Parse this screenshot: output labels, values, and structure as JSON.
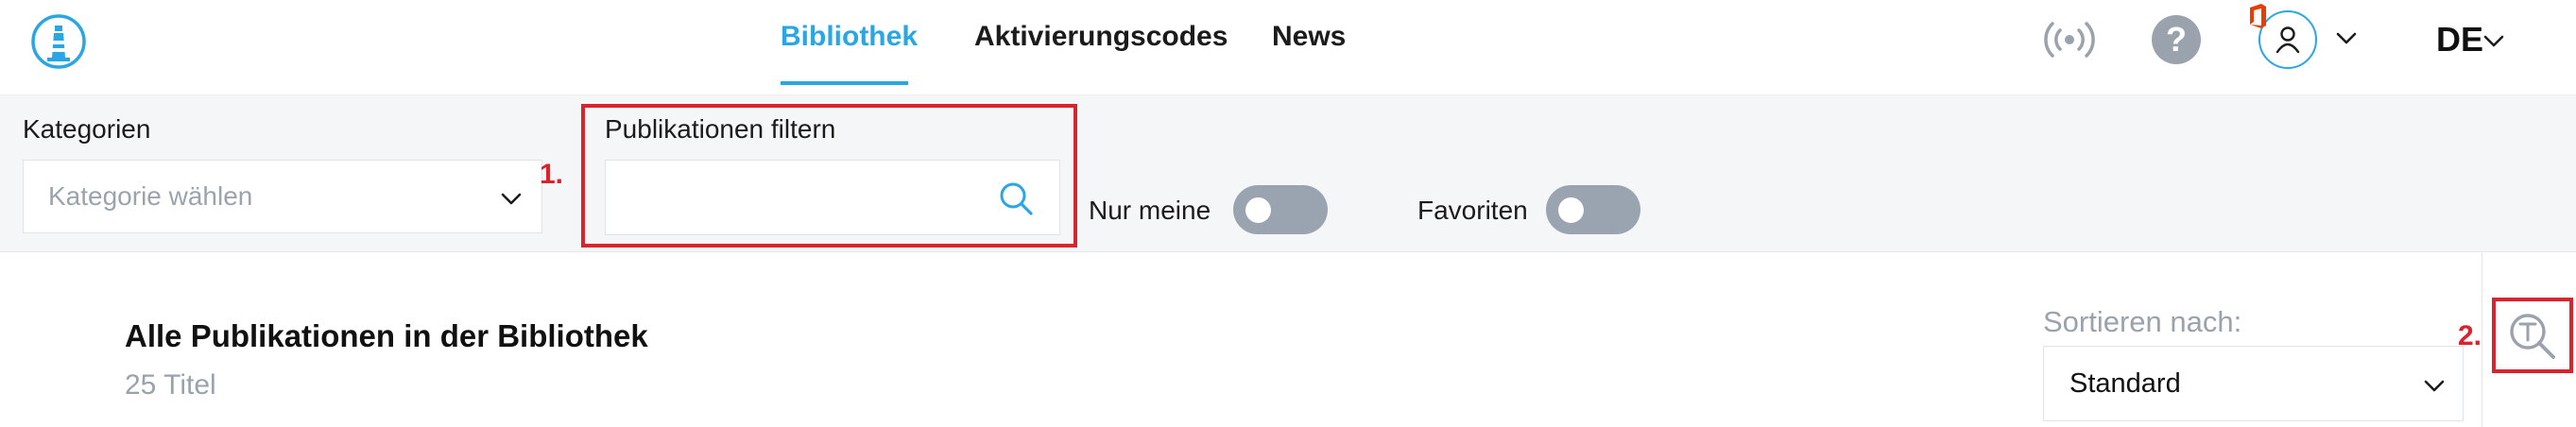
{
  "nav": {
    "items": [
      {
        "label": "Bibliothek",
        "active": true
      },
      {
        "label": "Aktivierungscodes",
        "active": false
      },
      {
        "label": "News",
        "active": false
      }
    ],
    "help_label": "?",
    "language": "DE"
  },
  "filters": {
    "category_label": "Kategorien",
    "category_placeholder": "Kategorie wählen",
    "publication_filter_label": "Publikationen filtern",
    "publication_filter_value": "",
    "only_mine_label": "Nur meine",
    "only_mine_on": false,
    "favorites_label": "Favoriten",
    "favorites_on": false
  },
  "content": {
    "title": "Alle Publikationen in der Bibliothek",
    "count": "25 Titel",
    "sort_label": "Sortieren nach:",
    "sort_value": "Standard"
  },
  "annotations": {
    "marker_1": "1.",
    "marker_2": "2."
  },
  "icons": [
    "lighthouse-logo-icon",
    "broadcast-icon",
    "help-icon",
    "office-icon",
    "user-icon",
    "chevron-down-icon",
    "search-icon",
    "text-search-icon"
  ],
  "colors": {
    "accent": "#2aa6e4",
    "annotation_red": "#d9232d",
    "toggle_off": "#9aa4b1",
    "muted_text": "#9aa2ac",
    "office_orange": "#eb3c00"
  }
}
